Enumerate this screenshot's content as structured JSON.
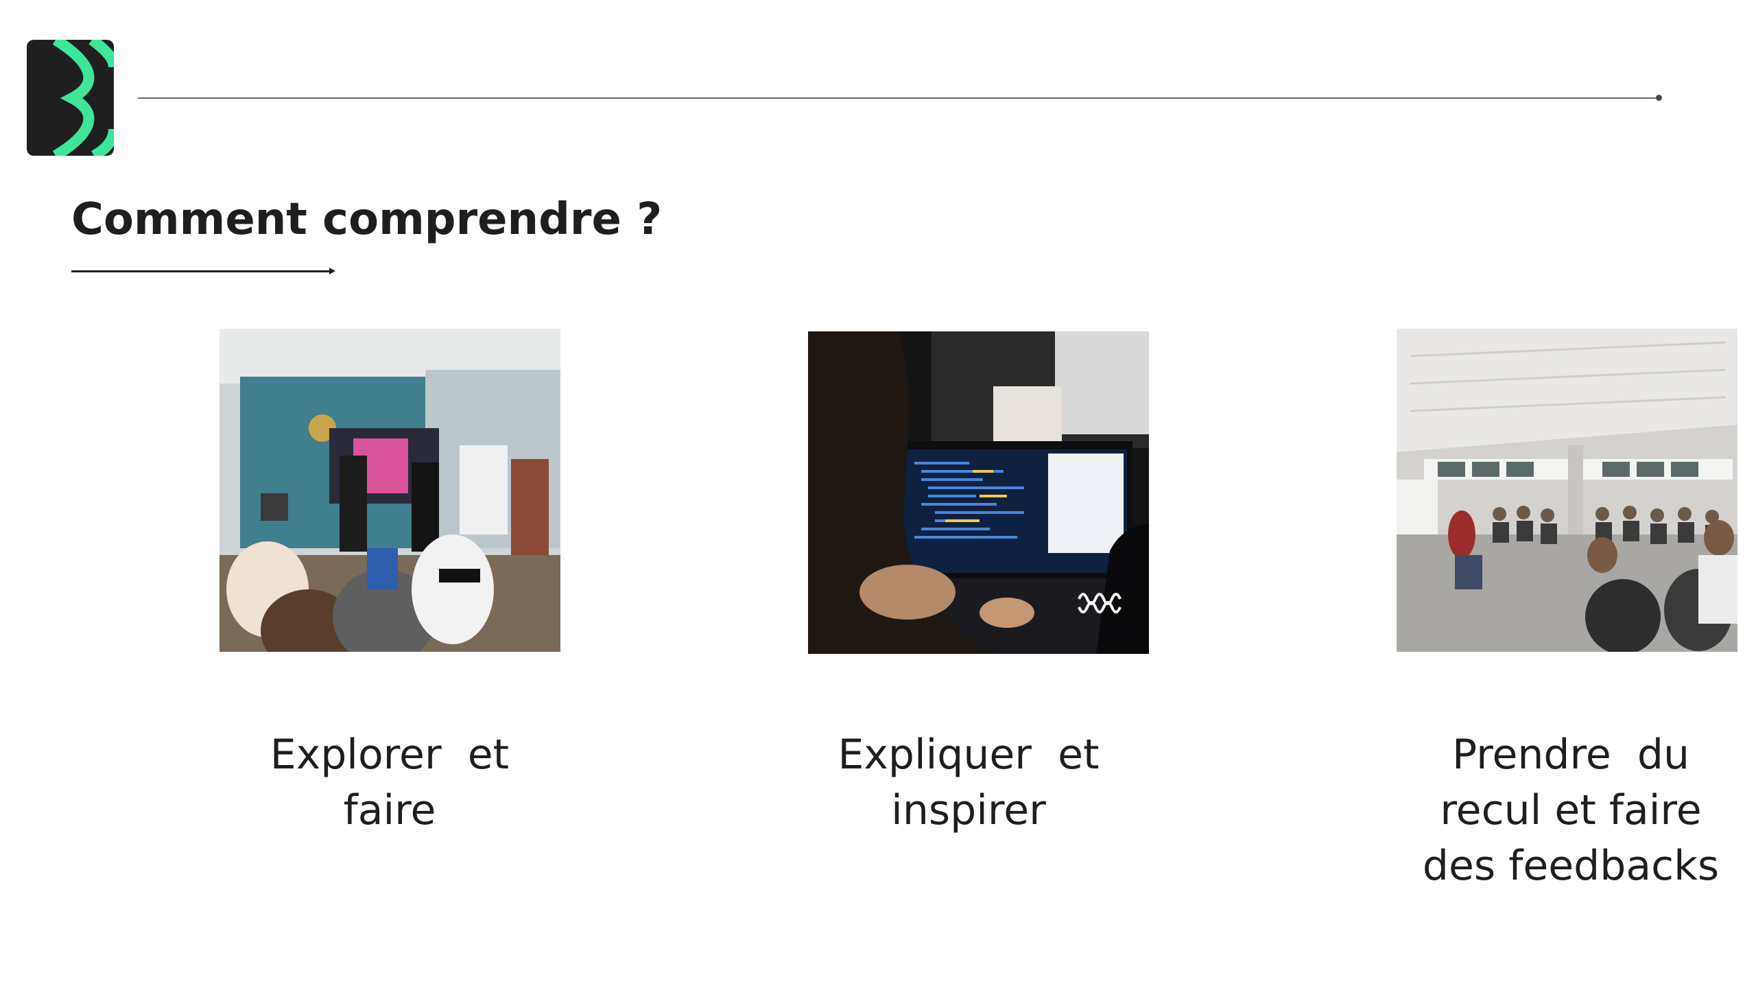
{
  "slide": {
    "title": "Comment comprendre ?",
    "logo_icon": "chevron-brand-logo",
    "brand_colors": {
      "logo_background": "#1f1f1f",
      "logo_accent": "#3ee59a",
      "text": "#1e1e1e",
      "rule": "#6b6b6b"
    }
  },
  "columns": [
    {
      "photo": "team-presentation-photo",
      "caption_lines": [
        "Explorer  et",
        "faire"
      ]
    },
    {
      "photo": "laptop-coding-photo",
      "caption_lines": [
        "Expliquer  et",
        "inspirer"
      ]
    },
    {
      "photo": "workshop-room-photo",
      "caption_lines": [
        "Prendre  du",
        "recul et faire",
        "des feedbacks"
      ]
    }
  ]
}
